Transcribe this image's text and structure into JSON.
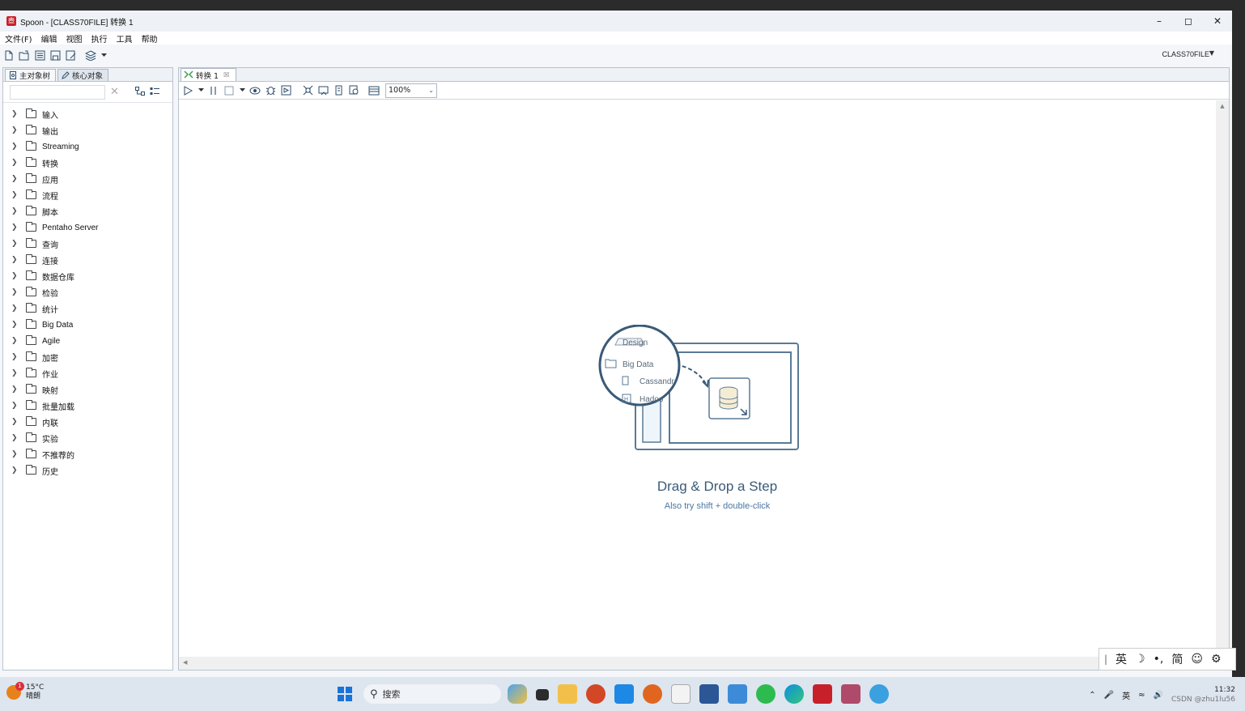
{
  "window": {
    "title": "Spoon - [CLASS70FILE] 转换 1",
    "app_icon_glyph": "壺"
  },
  "menu": [
    "文件(F)",
    "编辑",
    "视图",
    "执行",
    "工具",
    "帮助"
  ],
  "toolbar": {
    "repository_label": "CLASS70FILE"
  },
  "left_panel": {
    "tabs": [
      {
        "label": "主对象树",
        "icon": "doc-icon"
      },
      {
        "label": "核心对象",
        "icon": "pencil-icon"
      }
    ],
    "search_value": "",
    "tree_items": [
      "输入",
      "输出",
      "Streaming",
      "转换",
      "应用",
      "流程",
      "脚本",
      "Pentaho Server",
      "查询",
      "连接",
      "数据仓库",
      "检验",
      "统计",
      "Big Data",
      "Agile",
      "加密",
      "作业",
      "映射",
      "批量加载",
      "内联",
      "实验",
      "不推荐的",
      "历史"
    ]
  },
  "editor": {
    "tab_label": "转换 1",
    "zoom": "100%",
    "empty_state": {
      "title": "Drag & Drop a Step",
      "subtitle": "Also try shift + double-click",
      "illustration": {
        "tab": "Design",
        "folder": "Big Data",
        "item1": "Cassandr",
        "item2": "Hadoo"
      }
    }
  },
  "ime": [
    "英",
    "☽",
    "•,",
    "简",
    "☺",
    "⚙"
  ],
  "taskbar": {
    "weather_temp": "15°C",
    "weather_desc": "晴朗",
    "weather_badge": "1",
    "search_placeholder": "搜索",
    "tray_lang": "英",
    "clock_time": "11:32",
    "watermark": "CSDN @zhu1lu56"
  },
  "colors": {
    "accent": "#3a5a78",
    "subtitle": "#4a77a0",
    "panel_border": "#b9c3cf",
    "app_red": "#c8202a"
  }
}
